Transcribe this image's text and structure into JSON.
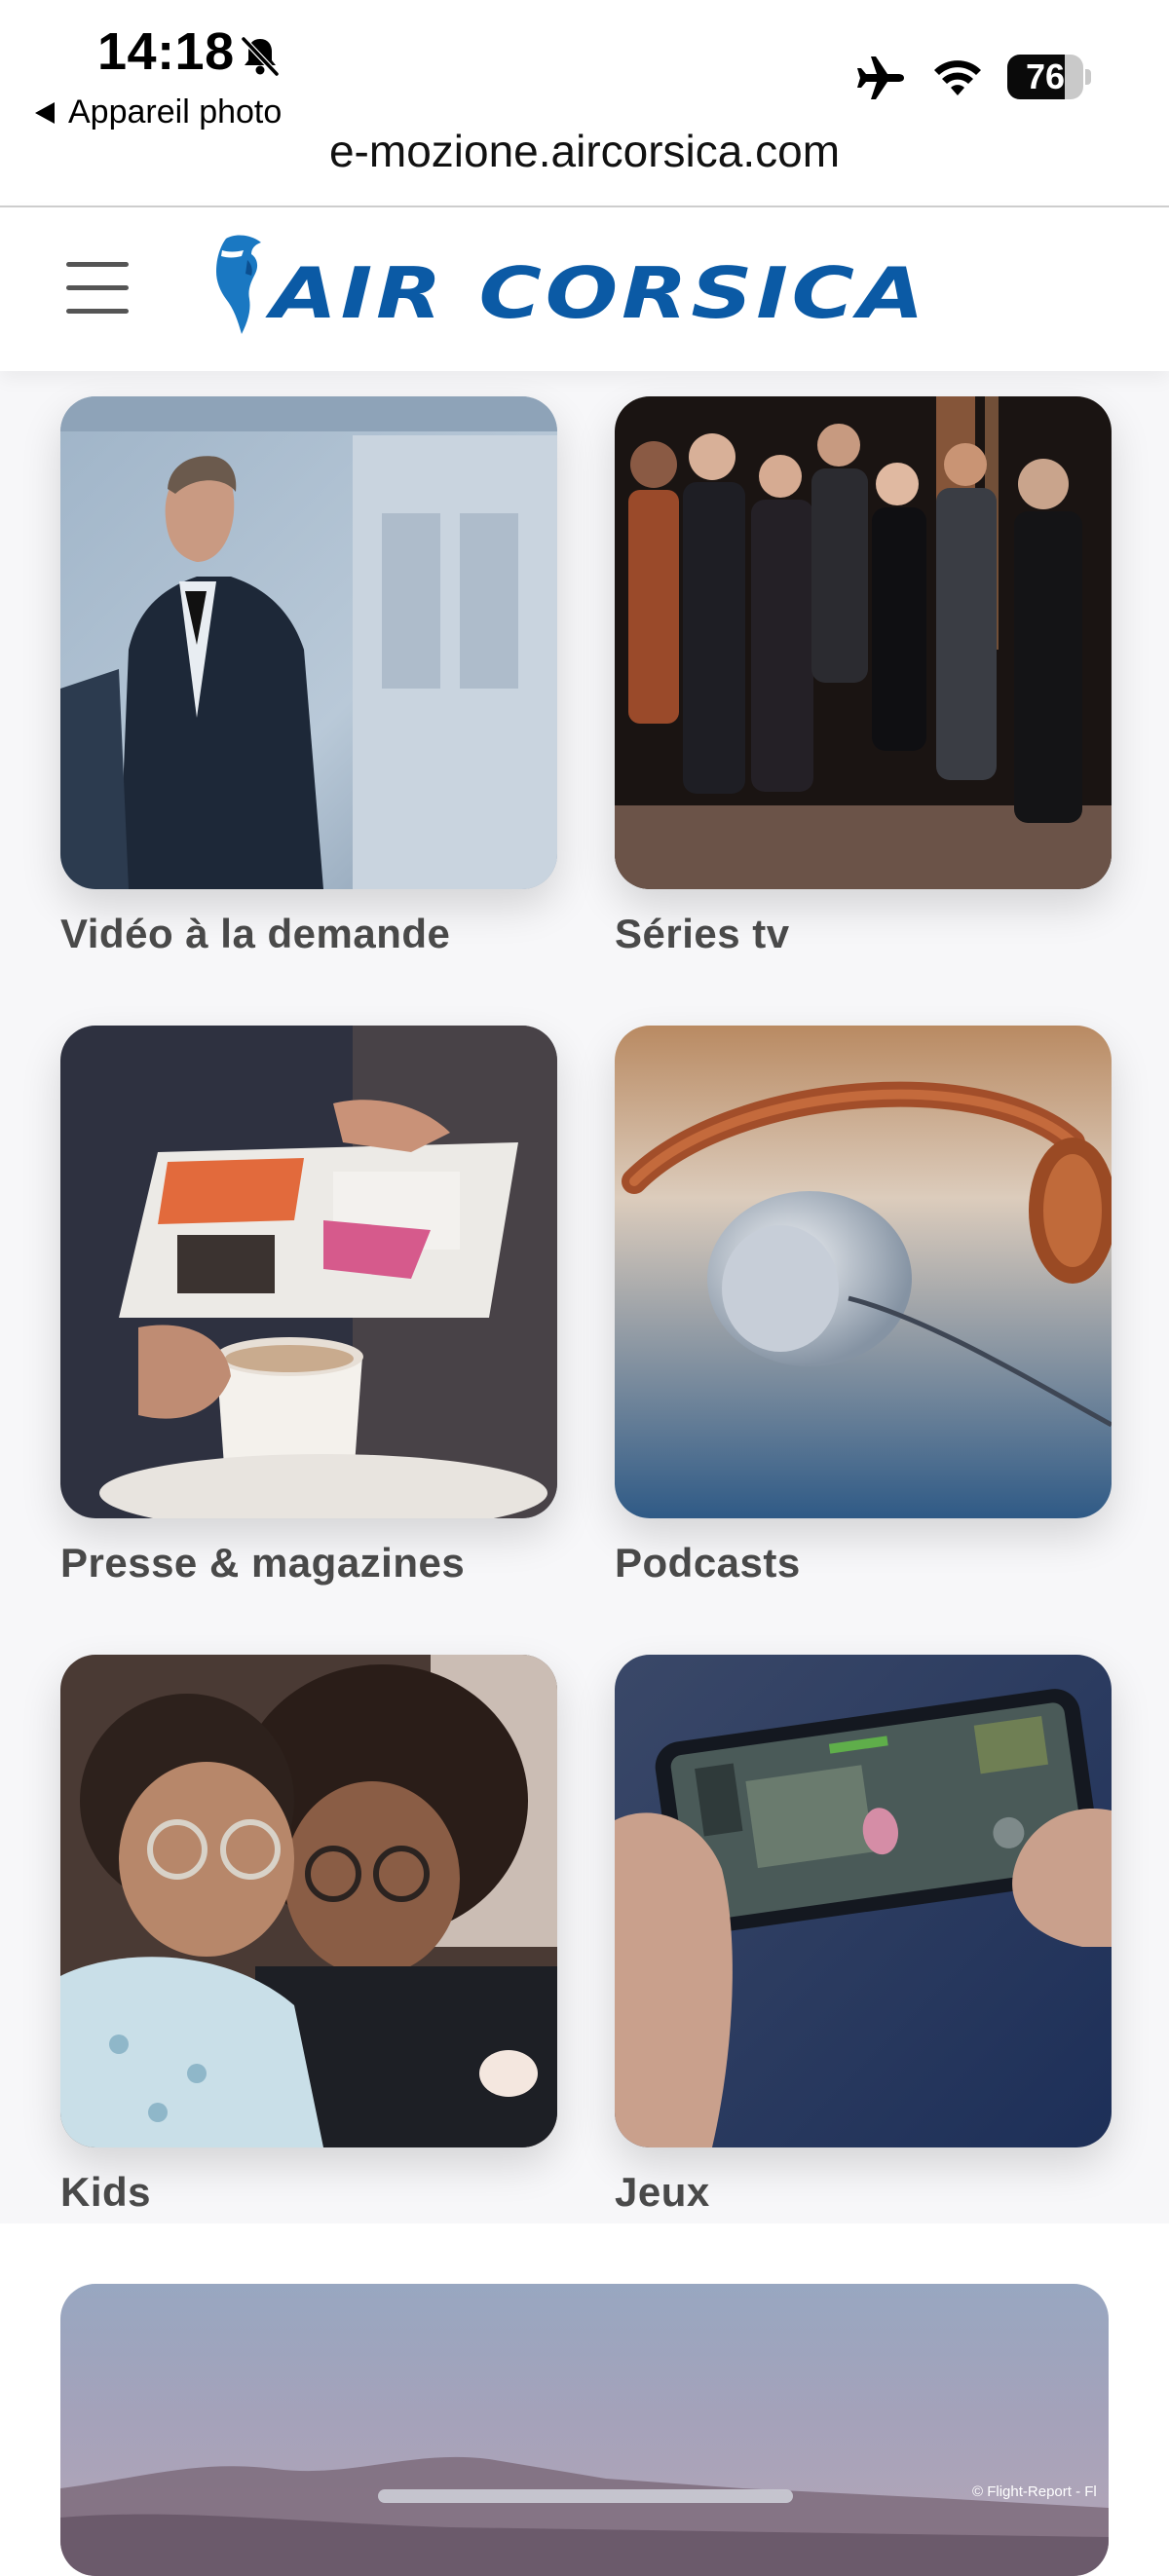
{
  "status_bar": {
    "time": "14:18",
    "back_app": "Appareil photo",
    "battery_level": "76",
    "battery_fraction": 0.76
  },
  "browser": {
    "url": "e-mozione.aircorsica.com"
  },
  "header": {
    "logo_text": "AIR CORSICA",
    "brand_color": "#0b5aa5"
  },
  "tiles": [
    {
      "label": "Vidéo à la demande",
      "image": "man-in-tuxedo-casino-image"
    },
    {
      "label": "Séries tv",
      "image": "tv-series-cast-image"
    },
    {
      "label": "Presse & magazines",
      "image": "reading-magazine-coffee-image"
    },
    {
      "label": "Podcasts",
      "image": "headphones-image"
    },
    {
      "label": "Kids",
      "image": "kids-with-glasses-image"
    },
    {
      "label": "Jeux",
      "image": "mobile-game-image"
    }
  ],
  "banner": {
    "credit": "© Flight-Report - Fl"
  },
  "icons": {
    "bell": "bell-slash-icon",
    "airplane": "airplane-icon",
    "wifi": "wifi-icon",
    "battery": "battery-icon",
    "menu": "hamburger-icon"
  }
}
